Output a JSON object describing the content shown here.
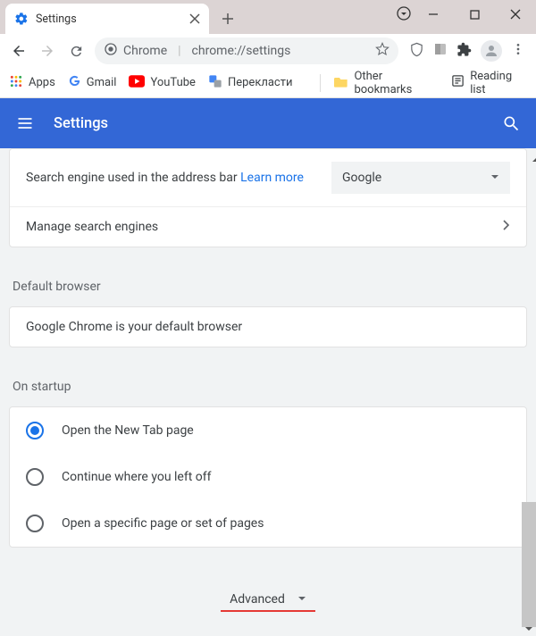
{
  "tab": {
    "title": "Settings"
  },
  "omnibox": {
    "label": "Chrome",
    "url": "chrome://settings"
  },
  "bookmarks": {
    "apps": "Apps",
    "gmail": "Gmail",
    "youtube": "YouTube",
    "translate": "Перекласти",
    "other": "Other bookmarks",
    "readinglist": "Reading list"
  },
  "header": {
    "title": "Settings"
  },
  "search_engine": {
    "label": "Search engine used in the address bar ",
    "learn_more": "Learn more",
    "selected": "Google",
    "manage": "Manage search engines"
  },
  "default_browser": {
    "section": "Default browser",
    "text": "Google Chrome is your default browser"
  },
  "startup": {
    "section": "On startup",
    "opt1": "Open the New Tab page",
    "opt2": "Continue where you left off",
    "opt3": "Open a specific page or set of pages"
  },
  "advanced": "Advanced"
}
